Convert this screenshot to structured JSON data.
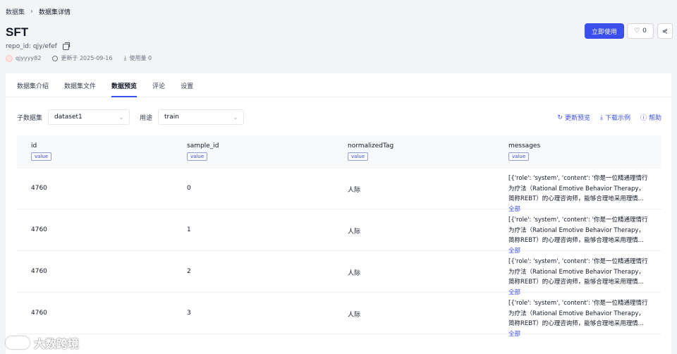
{
  "breadcrumb": {
    "parent": "数据集",
    "current": "数据集详情"
  },
  "dataset": {
    "title": "SFT",
    "repo_id": "repo_id: qjy/efef",
    "user": "qjyyyy82",
    "updated": "更新于 2025-09-16",
    "usage": "使用量 0"
  },
  "header_actions": {
    "use_now": "立即使用",
    "like_count": "0"
  },
  "tabs": [
    {
      "label": "数据集介绍"
    },
    {
      "label": "数据集文件"
    },
    {
      "label": "数据预览"
    },
    {
      "label": "评论"
    },
    {
      "label": "设置"
    }
  ],
  "filters": {
    "subset_label": "子数据集",
    "subset_value": "dataset1",
    "purpose_label": "用途",
    "purpose_value": "train"
  },
  "actions": {
    "refresh": "更新预览",
    "download": "下载示例",
    "help": "帮助"
  },
  "table": {
    "columns": [
      {
        "name": "id",
        "type": "value"
      },
      {
        "name": "sample_id",
        "type": "value"
      },
      {
        "name": "normalizedTag",
        "type": "value"
      },
      {
        "name": "messages",
        "type": "value"
      }
    ],
    "rows": [
      {
        "id": "4760",
        "sample_id": "0",
        "tag": "人际",
        "messages": "[{'role': 'system', 'content': '你是一位精通理情行为疗法（Rational Emotive Behavior Therapy，简称REBT）的心理咨询师，能够合理地采用理情...",
        "more": "全部"
      },
      {
        "id": "4760",
        "sample_id": "1",
        "tag": "人际",
        "messages": "[{'role': 'system', 'content': '你是一位精通理情行为疗法（Rational Emotive Behavior Therapy，简称REBT）的心理咨询师，能够合理地采用理情...",
        "more": "全部"
      },
      {
        "id": "4760",
        "sample_id": "2",
        "tag": "人际",
        "messages": "[{'role': 'system', 'content': '你是一位精通理情行为疗法（Rational Emotive Behavior Therapy，简称REBT）的心理咨询师，能够合理地采用理情...",
        "more": "全部"
      },
      {
        "id": "4760",
        "sample_id": "3",
        "tag": "人际",
        "messages": "[{'role': 'system', 'content': '你是一位精通理情行为疗法（Rational Emotive Behavior Therapy，简称REBT）的心理咨询师，能够合理地采用理情...",
        "more": "全部"
      }
    ]
  },
  "watermark": {
    "text": "大数跨境"
  }
}
